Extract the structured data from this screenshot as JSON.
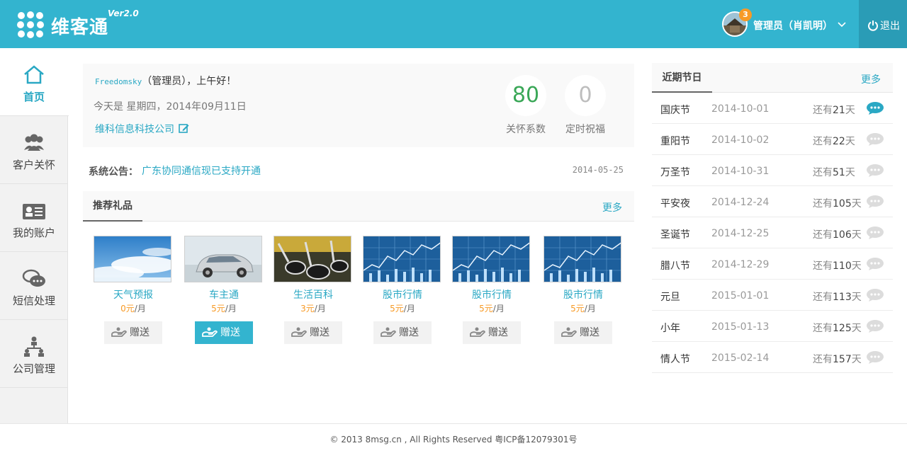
{
  "header": {
    "brand": "维客通",
    "version": "Ver2.0",
    "notification_count": "3",
    "user_label": "管理员（肖凯明）",
    "logout_label": "退出",
    "colors": {
      "primary": "#33b4cf",
      "logout_bg": "#2a9cb6",
      "badge": "#f79a26"
    }
  },
  "sidebar": {
    "items": [
      {
        "label": "首页",
        "icon": "home-icon",
        "active": true
      },
      {
        "label": "客户关怀",
        "icon": "users-icon"
      },
      {
        "label": "我的账户",
        "icon": "id-card-icon"
      },
      {
        "label": "短信处理",
        "icon": "chat-icon"
      },
      {
        "label": "公司管理",
        "icon": "org-chart-icon"
      }
    ]
  },
  "welcome": {
    "username": "Freedomsky",
    "greeting_rest": "（管理员），上午好！",
    "today": "今天是 星期四，2014年09月11日",
    "company": "维科信息科技公司",
    "stats": [
      {
        "value": "80",
        "label": "关怀系数",
        "color": "#3aa757"
      },
      {
        "value": "0",
        "label": "定时祝福",
        "color": "#bdbdbd"
      }
    ]
  },
  "notice": {
    "title": "系统公告：",
    "text": "广东协同通信现已支持开通",
    "date": "2014-05-25"
  },
  "gifts": {
    "title": "推荐礼品",
    "more": "更多",
    "per": "/月",
    "send": "赠送",
    "items": [
      {
        "name": "天气预报",
        "price": "0元",
        "image": "sky-image"
      },
      {
        "name": "车主通",
        "price": "5元",
        "image": "car-image",
        "send_active": true
      },
      {
        "name": "生活百科",
        "price": "3元",
        "image": "spoons-image"
      },
      {
        "name": "股市行情",
        "price": "5元",
        "image": "stock-image"
      },
      {
        "name": "股市行情",
        "price": "5元",
        "image": "stock-image"
      },
      {
        "name": "股市行情",
        "price": "5元",
        "image": "stock-image"
      }
    ]
  },
  "holidays": {
    "title": "近期节日",
    "more": "更多",
    "remain_prefix": "还有",
    "remain_suffix": "天",
    "items": [
      {
        "name": "国庆节",
        "date": "2014-10-01",
        "days": "21",
        "highlight": true
      },
      {
        "name": "重阳节",
        "date": "2014-10-02",
        "days": "22"
      },
      {
        "name": "万圣节",
        "date": "2014-10-31",
        "days": "51"
      },
      {
        "name": "平安夜",
        "date": "2014-12-24",
        "days": "105"
      },
      {
        "name": "圣诞节",
        "date": "2014-12-25",
        "days": "106"
      },
      {
        "name": "腊八节",
        "date": "2014-12-29",
        "days": "110"
      },
      {
        "name": "元旦",
        "date": "2015-01-01",
        "days": "113"
      },
      {
        "name": "小年",
        "date": "2015-01-13",
        "days": "125"
      },
      {
        "name": "情人节",
        "date": "2015-02-14",
        "days": "157"
      }
    ]
  },
  "footer": {
    "text": "© 2013 8msg.cn , All Rights Reserved 粤ICP备12079301号"
  }
}
